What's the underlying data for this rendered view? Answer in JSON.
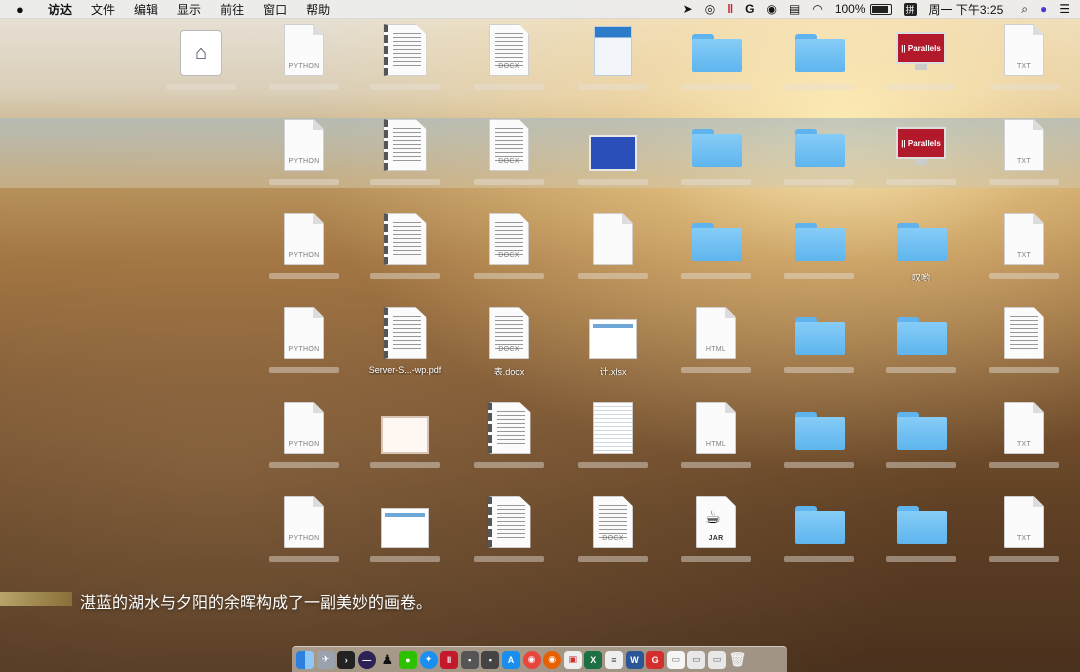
{
  "menubar": {
    "apple": "",
    "items": [
      "访达",
      "文件",
      "编辑",
      "显示",
      "前往",
      "窗口",
      "帮助"
    ],
    "status": {
      "battery": "100%",
      "input_method": "拼",
      "clock": "周一 下午3:25"
    },
    "status_icons": [
      "location-icon",
      "compass-icon",
      "parallels-icon",
      "sync-icon",
      "wechat-icon",
      "keyboard-icon",
      "wifi-icon",
      "battery-icon",
      "input-method-icon",
      "search-icon",
      "siri-icon",
      "notification-icon"
    ]
  },
  "desktop": {
    "labels": {
      "r2c9": "叹哟",
      "r3c2": "Server-S...-wp.pdf",
      "r3c3": "表.docx",
      "r3c4": "计.xlsx"
    },
    "file_tags": {
      "python": "PYTHON",
      "docx": "DOCX",
      "html": "HTML",
      "txt": "TXT",
      "jar": "JAR",
      "parallels": "|| Parallels"
    }
  },
  "caption": "湛蓝的湖水与夕阳的余晖构成了一副美妙的画卷。"
}
